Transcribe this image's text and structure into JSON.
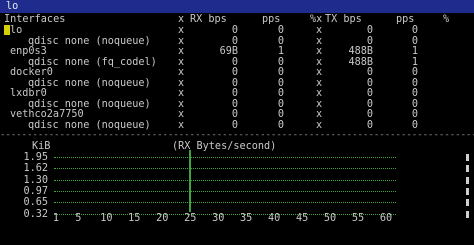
{
  "window": {
    "title": "lo"
  },
  "table": {
    "columns": {
      "interfaces": "Interfaces",
      "rx_x": "x",
      "rx_bps": "RX bps",
      "rx_pps": "pps",
      "tx_x": "%x",
      "tx_bps": "TX bps",
      "tx_pps": "pps",
      "pct": "%"
    },
    "rows": [
      {
        "name": "lo",
        "indent": 0,
        "selected": true,
        "rx_x": "x",
        "rx_bps": "0",
        "rx_pps": "0",
        "tx_x": "x",
        "tx_bps": "0",
        "tx_pps": "0"
      },
      {
        "name": "qdisc none (noqueue)",
        "indent": 1,
        "rx_x": "x",
        "rx_bps": "0",
        "rx_pps": "0",
        "tx_x": "x",
        "tx_bps": "0",
        "tx_pps": "0"
      },
      {
        "name": "enp0s3",
        "indent": 0,
        "rx_x": "x",
        "rx_bps": "69B",
        "rx_pps": "1",
        "tx_x": "x",
        "tx_bps": "488B",
        "tx_pps": "1"
      },
      {
        "name": "qdisc none (fq_codel)",
        "indent": 1,
        "rx_x": "x",
        "rx_bps": "0",
        "rx_pps": "0",
        "tx_x": "x",
        "tx_bps": "488B",
        "tx_pps": "1"
      },
      {
        "name": "docker0",
        "indent": 0,
        "rx_x": "x",
        "rx_bps": "0",
        "rx_pps": "0",
        "tx_x": "x",
        "tx_bps": "0",
        "tx_pps": "0"
      },
      {
        "name": "qdisc none (noqueue)",
        "indent": 1,
        "rx_x": "x",
        "rx_bps": "0",
        "rx_pps": "0",
        "tx_x": "x",
        "tx_bps": "0",
        "tx_pps": "0"
      },
      {
        "name": "lxdbr0",
        "indent": 0,
        "rx_x": "x",
        "rx_bps": "0",
        "rx_pps": "0",
        "tx_x": "x",
        "tx_bps": "0",
        "tx_pps": "0"
      },
      {
        "name": "qdisc none (noqueue)",
        "indent": 1,
        "rx_x": "x",
        "rx_bps": "0",
        "rx_pps": "0",
        "tx_x": "x",
        "tx_bps": "0",
        "tx_pps": "0"
      },
      {
        "name": "vethco2a7750",
        "indent": 0,
        "rx_x": "x",
        "rx_bps": "0",
        "rx_pps": "0",
        "tx_x": "x",
        "tx_bps": "0",
        "tx_pps": "0"
      },
      {
        "name": "qdisc none (noqueue)",
        "indent": 1,
        "rx_x": "x",
        "rx_bps": "0",
        "rx_pps": "0",
        "tx_x": "x",
        "tx_bps": "0",
        "tx_pps": "0"
      }
    ]
  },
  "graph": {
    "unit_label": "KiB",
    "title": "(RX Bytes/second)",
    "y_ticks": [
      "1.95",
      "1.62",
      "1.30",
      "0.97",
      "0.65",
      "0.32"
    ],
    "x_ticks": [
      "1",
      "5",
      "10",
      "15",
      "20",
      "25",
      "30",
      "35",
      "40",
      "45",
      "50",
      "55",
      "60"
    ],
    "color": "#3ea43e",
    "spike_at": 25
  },
  "colors": {
    "titlebar": "#1f2c8e",
    "cursor": "#d8d000",
    "text": "#c8c8c8"
  }
}
